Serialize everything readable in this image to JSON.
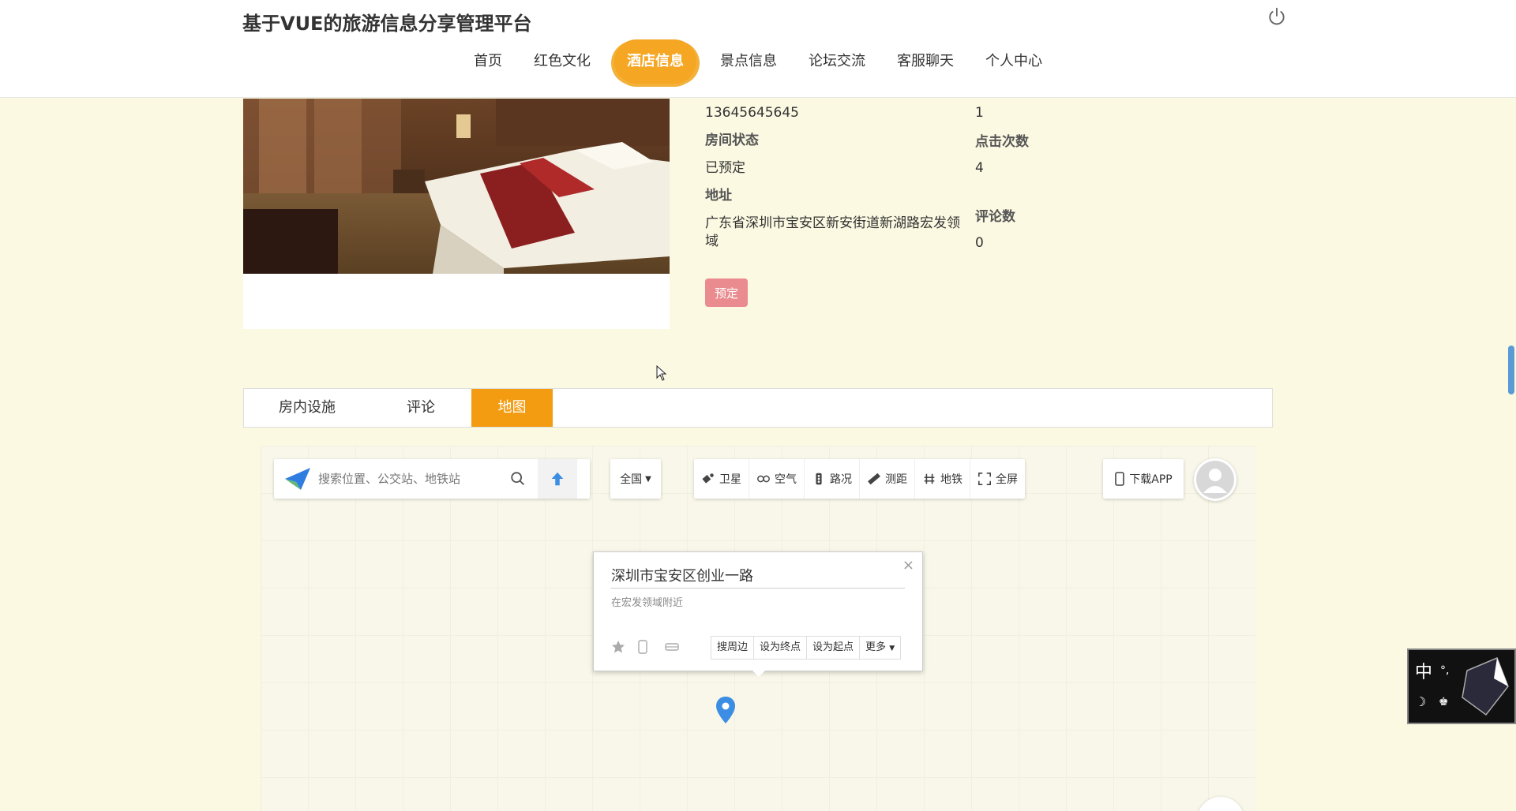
{
  "site_title": "基于VUE的旅游信息分享管理平台",
  "nav": [
    {
      "label": "首页"
    },
    {
      "label": "红色文化"
    },
    {
      "label": "酒店信息",
      "active": true
    },
    {
      "label": "景点信息"
    },
    {
      "label": "论坛交流"
    },
    {
      "label": "客服聊天"
    },
    {
      "label": "个人中心"
    }
  ],
  "info": {
    "phone_value": "13645645645",
    "right_top_value": "1",
    "room_status_label": "房间状态",
    "room_status_value": "已预定",
    "clicks_label": "点击次数",
    "clicks_value": "4",
    "address_label": "地址",
    "address_value": "广东省深圳市宝安区新安街道新湖路宏发领域",
    "comments_label": "评论数",
    "comments_value": "0",
    "book_button": "预定"
  },
  "tabs": [
    {
      "label": "房内设施"
    },
    {
      "label": "评论"
    },
    {
      "label": "地图",
      "active": true
    }
  ],
  "map": {
    "search_placeholder": "搜索位置、公交站、地铁站",
    "region": "全国",
    "tools": [
      "卫星",
      "空气",
      "路况",
      "测距",
      "地铁",
      "全屏"
    ],
    "download": "下载APP",
    "popup_title": "深圳市宝安区创业一路",
    "popup_sub": "在宏发领域附近",
    "popup_actions": [
      "搜周边",
      "设为终点",
      "设为起点",
      "更多"
    ]
  },
  "ime_char": "中",
  "colors": {
    "accent": "#f39c12",
    "book": "#e98b8f",
    "page_bg": "#fbf9e2"
  }
}
